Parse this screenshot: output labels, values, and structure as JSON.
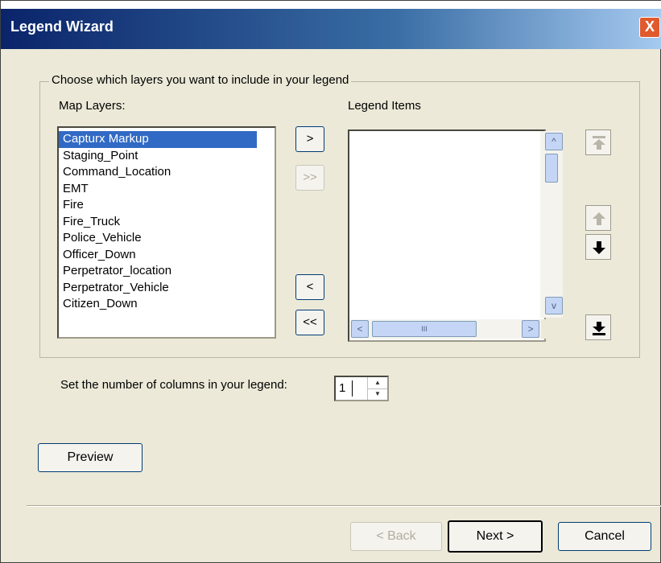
{
  "window": {
    "title": "Legend Wizard",
    "close_glyph": "X"
  },
  "group": {
    "title": "Choose which layers you want to include in your legend"
  },
  "map_layers": {
    "label": "Map Layers:",
    "items": [
      {
        "label": "Capturx Markup",
        "selected": true
      },
      {
        "label": "Staging_Point",
        "selected": false
      },
      {
        "label": "Command_Location",
        "selected": false
      },
      {
        "label": "EMT",
        "selected": false
      },
      {
        "label": "Fire",
        "selected": false
      },
      {
        "label": "Fire_Truck",
        "selected": false
      },
      {
        "label": "Police_Vehicle",
        "selected": false
      },
      {
        "label": "Officer_Down",
        "selected": false
      },
      {
        "label": "Perpetrator_location",
        "selected": false
      },
      {
        "label": "Perpetrator_Vehicle",
        "selected": false
      },
      {
        "label": "Citizen_Down",
        "selected": false
      }
    ]
  },
  "transfer_buttons": {
    "add": ">",
    "add_all": ">>",
    "remove": "<",
    "remove_all": "<<"
  },
  "legend_items": {
    "label": "Legend Items",
    "items": []
  },
  "scrollbar": {
    "up": "^",
    "down": "v",
    "left": "<",
    "right": ">",
    "thumb_grip": "III"
  },
  "columns": {
    "label": "Set the number of columns in your legend:",
    "value": "1"
  },
  "preview_label": "Preview",
  "nav": {
    "back": "< Back",
    "next": "Next >",
    "cancel": "Cancel"
  },
  "colors": {
    "title_bar": "#0a246a",
    "selection": "#316ac5",
    "dialog_bg": "#ece9d8"
  }
}
